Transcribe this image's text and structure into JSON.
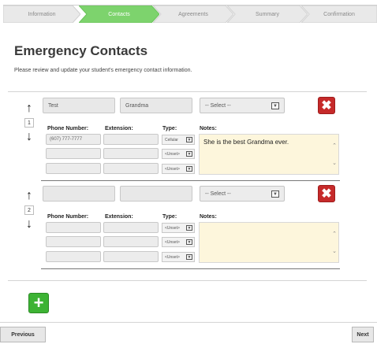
{
  "steps": [
    {
      "label": "Information",
      "active": false
    },
    {
      "label": "Contacts",
      "active": true
    },
    {
      "label": "Agreements",
      "active": false
    },
    {
      "label": "Summary",
      "active": false
    },
    {
      "label": "Confirmation",
      "active": false
    }
  ],
  "colors": {
    "active_step": "#7dd36d",
    "inactive_step": "#e9e9e9",
    "delete": "#c62a2a",
    "add": "#3db334",
    "notes_bg": "#fdf6dc"
  },
  "page": {
    "title": "Emergency Contacts",
    "subtitle": "Please review and update your student's emergency contact information."
  },
  "contacts": [
    {
      "index": "1",
      "first_name": "Test",
      "last_name": "Grandma",
      "relationship": "-- Select --",
      "labels": {
        "phone": "Phone Number:",
        "ext": "Extension:",
        "type": "Type:",
        "notes": "Notes:"
      },
      "phones": [
        {
          "number": "(607) 777-7777",
          "ext": "",
          "type": "Cellular"
        },
        {
          "number": "",
          "ext": "",
          "type": "<Unset>"
        },
        {
          "number": "",
          "ext": "",
          "type": "<Unset>"
        }
      ],
      "notes": "She is the best Grandma ever."
    },
    {
      "index": "2",
      "first_name": "",
      "last_name": "",
      "relationship": "-- Select --",
      "labels": {
        "phone": "Phone Number:",
        "ext": "Extension:",
        "type": "Type:",
        "notes": "Notes:"
      },
      "phones": [
        {
          "number": "",
          "ext": "",
          "type": "<Unset>"
        },
        {
          "number": "",
          "ext": "",
          "type": "<Unset>"
        },
        {
          "number": "",
          "ext": "",
          "type": "<Unset>"
        }
      ],
      "notes": ""
    }
  ],
  "icons": {
    "up": "arrow-up-icon",
    "down": "arrow-down-icon",
    "delete": "close-icon",
    "add": "plus-icon"
  },
  "nav": {
    "previous": "Previous",
    "next": "Next"
  }
}
